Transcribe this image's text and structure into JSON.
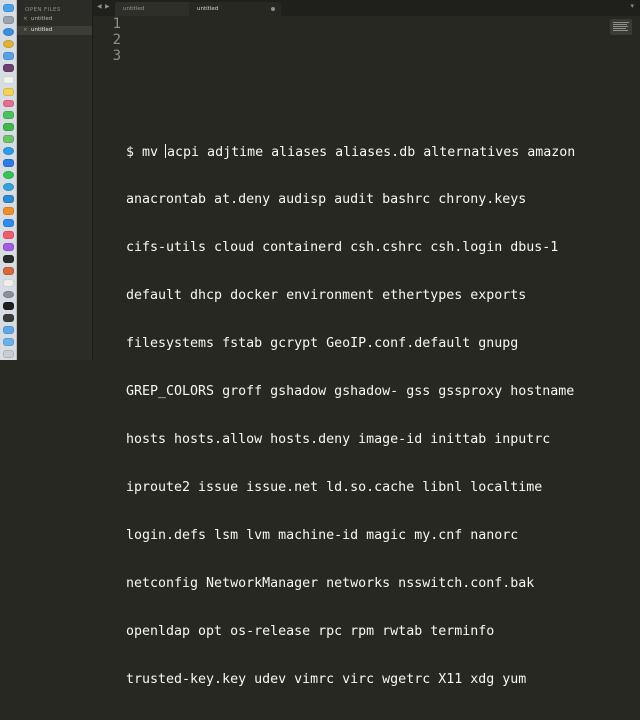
{
  "sidebar": {
    "header": "OPEN FILES",
    "files": [
      {
        "name": "untitled",
        "active": false
      },
      {
        "name": "untitled",
        "active": true
      }
    ]
  },
  "tabs": [
    {
      "label": "untitled",
      "active": false
    },
    {
      "label": "untitled",
      "active": true
    }
  ],
  "editor": {
    "line_numbers": [
      "1",
      "2",
      "3"
    ],
    "command_prefix": "$ mv ",
    "command_rest": "acpi adjtime aliases aliases.db alternatives amazon",
    "continuation_lines": [
      "anacrontab at.deny audisp audit bashrc chrony.keys",
      "cifs-utils cloud containerd csh.cshrc csh.login dbus-1",
      "default dhcp docker environment ethertypes exports",
      "filesystems fstab gcrypt GeoIP.conf.default gnupg",
      "GREP_COLORS groff gshadow gshadow- gss gssproxy hostname",
      "hosts hosts.allow hosts.deny image-id inittab inputrc",
      "iproute2 issue issue.net ld.so.cache libnl localtime",
      "login.defs lsm lvm machine-id magic my.cnf nanorc",
      "netconfig NetworkManager networks nsswitch.conf.bak",
      "openldap opt os-release rpc rpm rwtab terminfo",
      "trusted-key.key udev vimrc virc wgetrc X11 xdg yum"
    ]
  },
  "colors": {
    "editor_bg": "#272822",
    "text": "#f8f8f2",
    "gutter_text": "#8f908a",
    "sidebar_bg": "#2b2c26"
  }
}
